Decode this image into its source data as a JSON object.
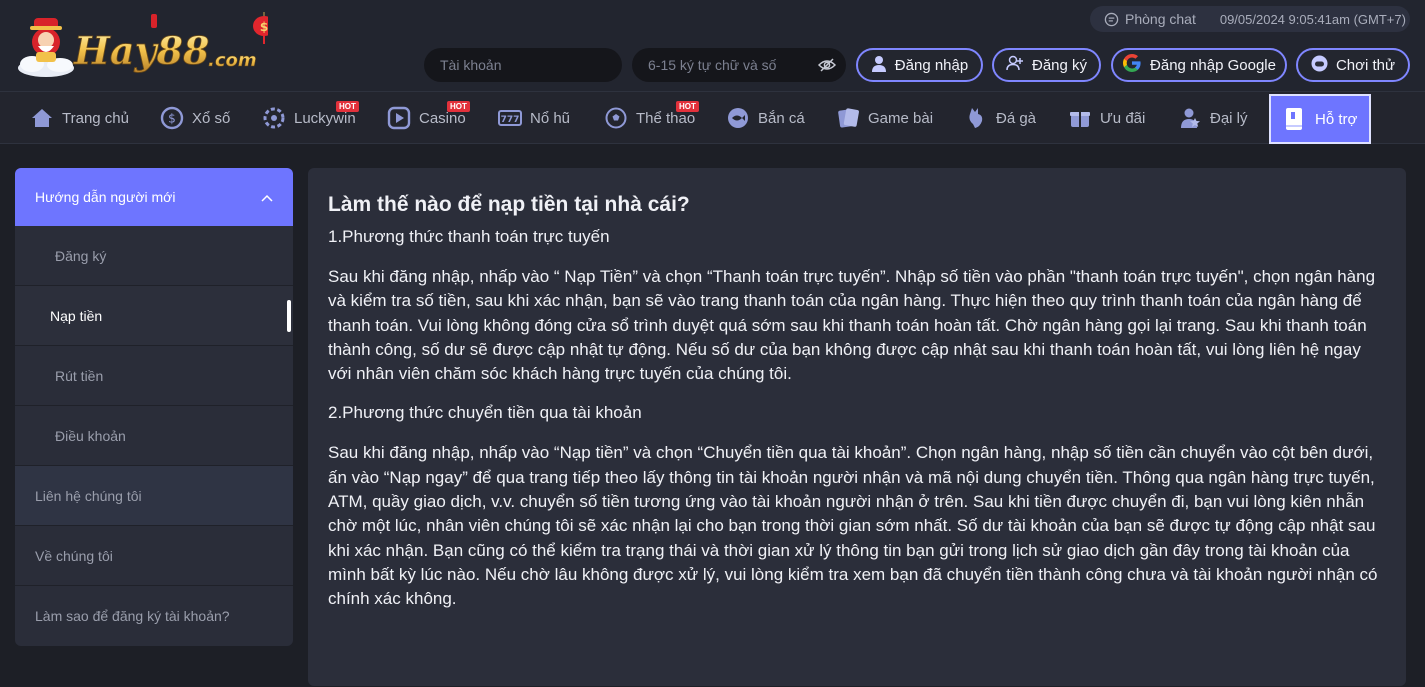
{
  "header": {
    "chat_label": "Phòng chat",
    "datetime": "09/05/2024 9:05:41am  (GMT+7)",
    "username_placeholder": "Tài khoản",
    "password_placeholder": "6-15 ký tự chữ và số",
    "login_label": "Đăng nhập",
    "register_label": "Đăng ký",
    "google_login_label": "Đăng nhập Google",
    "try_label": "Chơi thử",
    "accent_color": "#6e75ff"
  },
  "nav": {
    "items": [
      {
        "label": "Trang chủ",
        "icon": "home-icon"
      },
      {
        "label": "Xổ số",
        "icon": "lottery-coin-icon"
      },
      {
        "label": "Luckywin",
        "icon": "wheel-icon",
        "badge": "HOT"
      },
      {
        "label": "Casino",
        "icon": "play-icon",
        "badge": "HOT"
      },
      {
        "label": "Nổ hũ",
        "icon": "slot-777-icon"
      },
      {
        "label": "Thể thao",
        "icon": "soccer-ball-icon",
        "badge": "HOT"
      },
      {
        "label": "Bắn cá",
        "icon": "fish-icon"
      },
      {
        "label": "Game bài",
        "icon": "card-icon"
      },
      {
        "label": "Đá gà",
        "icon": "rooster-icon"
      },
      {
        "label": "Ưu đãi",
        "icon": "gift-icon"
      },
      {
        "label": "Đại lý",
        "icon": "agent-icon"
      },
      {
        "label": "Hỗ trợ",
        "icon": "book-icon",
        "active": true
      }
    ]
  },
  "sidebar": {
    "group_title": "Hướng dẫn người mới",
    "sub_items": [
      "Đăng ký",
      "Nạp tiền",
      "Rút tiền",
      "Điều khoản"
    ],
    "active_sub_item": "Nạp tiền",
    "items": [
      "Liên hệ chúng tôi",
      "Về chúng tôi",
      "Làm sao để đăng ký tài khoản?"
    ]
  },
  "content": {
    "title": "Làm thế nào để nạp tiền tại nhà cái?",
    "section1_heading": "1.Phương thức thanh toán trực tuyến",
    "section1_body": "Sau khi đăng nhập, nhấp vào “ Nạp Tiền” và chọn “Thanh toán trực tuyến”. Nhập số tiền vào phần \"thanh toán trực tuyến\", chọn ngân hàng và kiểm tra số tiền, sau khi xác nhận, bạn sẽ vào trang thanh toán của ngân hàng. Thực hiện theo quy trình thanh toán của ngân hàng để thanh toán. Vui lòng không đóng cửa sổ trình duyệt quá sớm sau khi thanh toán hoàn tất. Chờ ngân hàng gọi lại trang. Sau khi thanh toán thành công, số dư sẽ được cập nhật tự động. Nếu số dư của bạn không được cập nhật sau khi thanh toán hoàn tất, vui lòng liên hệ ngay với nhân viên chăm sóc khách hàng trực tuyến của chúng tôi.",
    "section2_heading": "2.Phương thức chuyển tiền qua tài khoản",
    "section2_body": "Sau khi đăng nhập, nhấp vào “Nạp tiền” và chọn “Chuyển tiền qua tài khoản”. Chọn ngân hàng, nhập số tiền cần chuyển vào cột bên dưới, ấn vào “Nạp ngay” để qua trang tiếp theo lấy thông tin tài khoản người nhận và mã nội dung chuyển tiền. Thông qua ngân hàng trực tuyến, ATM, quầy giao dịch, v.v. chuyển số tiền tương ứng vào tài khoản người nhận ở trên. Sau khi tiền được chuyển đi, bạn vui lòng kiên nhẫn chờ một lúc, nhân viên chúng tôi sẽ xác nhận lại cho bạn trong thời gian sớm nhất. Số dư tài khoản của bạn sẽ được tự động cập nhật sau khi xác nhận. Bạn cũng có thể kiểm tra trạng thái và thời gian xử lý thông tin bạn gửi trong lịch sử giao dịch gần đây trong tài khoản của mình bất kỳ lúc nào. Nếu chờ lâu không được xử lý, vui lòng kiểm tra xem bạn đã chuyển tiền thành công chưa và tài khoản người nhận có chính xác không."
  }
}
